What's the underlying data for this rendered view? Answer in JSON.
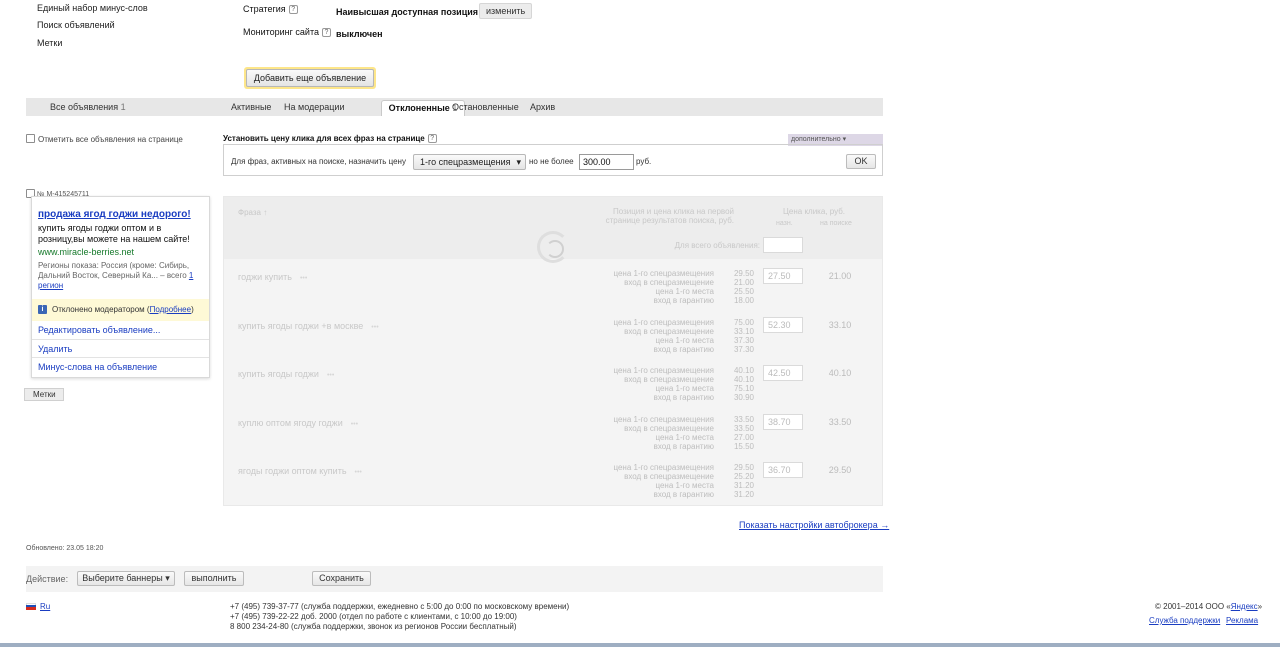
{
  "left_menu": {
    "items": [
      "Единый набор минус-слов",
      "Поиск объявлений",
      "Метки"
    ]
  },
  "strategy": {
    "label": "Стратегия",
    "help": "?",
    "value": "Наивысшая доступная позиция",
    "change_button": "изменить"
  },
  "monitoring": {
    "label": "Мониторинг сайта",
    "help": "?",
    "value": "выключен"
  },
  "add_ad_button": "Добавить еще объявление",
  "tabs": {
    "all_label": "Все объявления",
    "all_count": "1",
    "active": "Активные",
    "moderation": "На модерации",
    "rejected_label": "Отклоненные",
    "rejected_count": "1",
    "stopped": "Остановленные",
    "archive": "Архив"
  },
  "select_all_label": "Отметить все объявления на странице",
  "price_panel": {
    "title": "Установить цену клика для всех фраз на странице",
    "help": "?",
    "extra_tab": "дополнительно ▾",
    "prefix": "Для фраз, активных на поиске, назначить цену",
    "position_select": "1-го спецразмещения",
    "max_label": "но не более",
    "max_value": "300.00",
    "currency": "руб.",
    "ok": "OK"
  },
  "ad": {
    "number": "№ M-415245711",
    "title": "продажа ягод годжи недорого!",
    "text": "купить ягоды годжи оптом и в розницу,вы можете на нашем сайте!",
    "url": "www.miracle-berries.net",
    "regions_text": "Регионы показа: Россия (кроме: Сибирь, Дальний Восток, Северный Ка... – всего ",
    "regions_link": "1 регион",
    "rejected_text": "Отклонено модератором (",
    "rejected_link": "Подробнее",
    "rejected_close": ")",
    "info_icon": "i",
    "actions": [
      "Редактировать объявление...",
      "Удалить",
      "Минус-слова на объявление"
    ]
  },
  "tags_button": "Метки",
  "table": {
    "col_phrase": "Фраза ↑",
    "col_position": "Позиция и цена клика на первой странице результатов поиска, руб.",
    "col_price": "Цена клика, руб.",
    "col_price_sub_left": "назн.",
    "col_price_sub_right": "на поиске",
    "all_ad_label": "Для всего объявления:",
    "position_labels": [
      "цена 1-го спецразмещения",
      "вход в спецразмещение",
      "цена 1-го места",
      "вход в гарантию"
    ],
    "rows": [
      {
        "phrase": "годжи купить",
        "values": [
          "29.50",
          "21.00",
          "25.50",
          "18.00"
        ],
        "price": "27.50",
        "search": "21.00"
      },
      {
        "phrase": "купить ягоды годжи +в москве",
        "values": [
          "75.00",
          "33.10",
          "37.30",
          "37.30"
        ],
        "price": "52.30",
        "search": "33.10"
      },
      {
        "phrase": "купить ягоды годжи",
        "values": [
          "40.10",
          "40.10",
          "75.10",
          "30.90"
        ],
        "price": "42.50",
        "search": "40.10"
      },
      {
        "phrase": "куплю оптом ягоду годжи",
        "values": [
          "33.50",
          "33.50",
          "27.00",
          "15.50"
        ],
        "price": "38.70",
        "search": "33.50"
      },
      {
        "phrase": "ягоды годжи оптом купить",
        "values": [
          "29.50",
          "25.20",
          "31.20",
          "31.20"
        ],
        "price": "36.70",
        "search": "29.50"
      }
    ]
  },
  "autobroker_link": "Показать настройки автоброкера →",
  "updated": "Обновлено: 23.05 18:20",
  "bottom": {
    "action_label": "Действие:",
    "select_banners": "Выберите баннеры ▾",
    "execute": "выполнить",
    "save": "Сохранить"
  },
  "footer": {
    "lang": "Ru",
    "phone1": "+7 (495) 739-37-77 (служба поддержки, ежедневно с 5:00 до 0:00 по московскому времени)",
    "phone2": "+7 (495) 739-22-22 доб. 2000 (отдел по работе с клиентами, с 10:00 до 19:00)",
    "phone3": "8 800 234-24-80 (служба поддержки, звонок из регионов России бесплатный)",
    "copyright_prefix": "© 2001–2014  ООО «",
    "copyright_link": "Яндекс",
    "copyright_suffix": "»",
    "support_link": "Служба поддержки",
    "ads_link": "Реклама"
  }
}
